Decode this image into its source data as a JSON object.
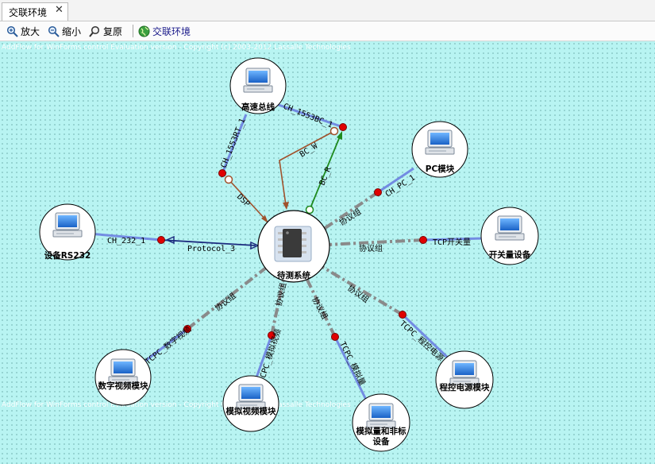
{
  "tab": {
    "label": "交联环境",
    "close": "✕"
  },
  "toolbar": {
    "zoom_in": "放大",
    "zoom_out": "缩小",
    "reset": "复原",
    "env": "交联环境"
  },
  "watermark": "AddFlow for WinForms control Evaluation version - Copyright (c) 2003-2012 Lassalle Technologies",
  "center": {
    "label": "待测系统"
  },
  "nodes": [
    {
      "id": "bus",
      "label": "高速总线"
    },
    {
      "id": "pc",
      "label": "PC模块"
    },
    {
      "id": "switch",
      "label": "开关量设备"
    },
    {
      "id": "rs232",
      "label": "设备RS232"
    },
    {
      "id": "dv",
      "label": "数字视频模块"
    },
    {
      "id": "av",
      "label": "模拟视频模块"
    },
    {
      "id": "ana",
      "label": "模拟量和非标设备"
    },
    {
      "id": "pwr",
      "label": "程控电源模块"
    }
  ],
  "links": {
    "ch1553rt": "CH_1553RT_1",
    "ch1553bc": "CH_1553BC_1",
    "dsp": "DSP",
    "bcw": "BC_W",
    "bcr": "BC_R",
    "chpc": "CH_PC_1",
    "tcp": "TCP开关量",
    "ch232": "CH_232_1",
    "protocol": "Protocol_3",
    "dv": "TCPC_数字视频",
    "av": "TCPC_模拟视频",
    "ana": "TCPC_模拟量",
    "pwr": "TCPC_程控电源",
    "group": "协议组"
  }
}
